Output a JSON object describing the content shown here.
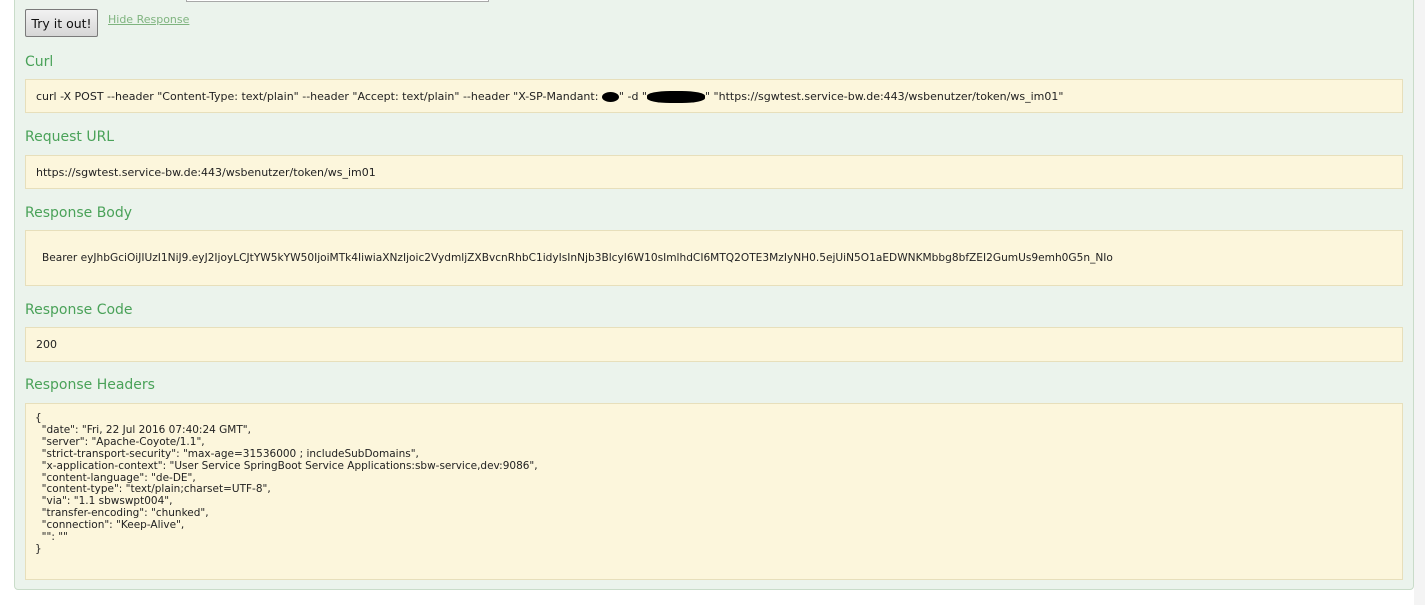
{
  "controls": {
    "try_button": "Try it out!",
    "hide_response_link": "Hide Response"
  },
  "curl": {
    "label": "Curl",
    "command_part1": "curl -X POST --header \"Content-Type: text/plain\" --header \"Accept: text/plain\" --header \"X-SP-Mandant: ",
    "command_part2": "\" -d \"",
    "command_part3": "\" \"https://sgwtest.service-bw.de:443/wsbenutzer/token/ws_im01\""
  },
  "request_url": {
    "label": "Request URL",
    "value": "https://sgwtest.service-bw.de:443/wsbenutzer/token/ws_im01"
  },
  "response_body": {
    "label": "Response Body",
    "value": "Bearer eyJhbGciOiJIUzI1NiJ9.eyJ2IjoyLCJtYW5kYW50IjoiMTk4IiwiaXNzIjoic2VydmljZXBvcnRhbC1idyIsInNjb3BlcyI6W10sImlhdCI6MTQ2OTE3MzIyNH0.5ejUiN5O1aEDWNKMbbg8bfZEI2GumUs9emh0G5n_NIo"
  },
  "response_code": {
    "label": "Response Code",
    "value": "200"
  },
  "response_headers": {
    "label": "Response Headers",
    "value": "{\n  \"date\": \"Fri, 22 Jul 2016 07:40:24 GMT\",\n  \"server\": \"Apache-Coyote/1.1\",\n  \"strict-transport-security\": \"max-age=31536000 ; includeSubDomains\",\n  \"x-application-context\": \"User Service SpringBoot Service Applications:sbw-service,dev:9086\",\n  \"content-language\": \"de-DE\",\n  \"content-type\": \"text/plain;charset=UTF-8\",\n  \"via\": \"1.1 sbwswpt004\",\n  \"transfer-encoding\": \"chunked\",\n  \"connection\": \"Keep-Alive\",\n  \"\": \"\"\n}"
  },
  "colors": {
    "panel_background": "#ebf3ec",
    "label_green": "#4aa259",
    "box_background": "#fcf6dc",
    "link_green": "#7fb47f"
  }
}
